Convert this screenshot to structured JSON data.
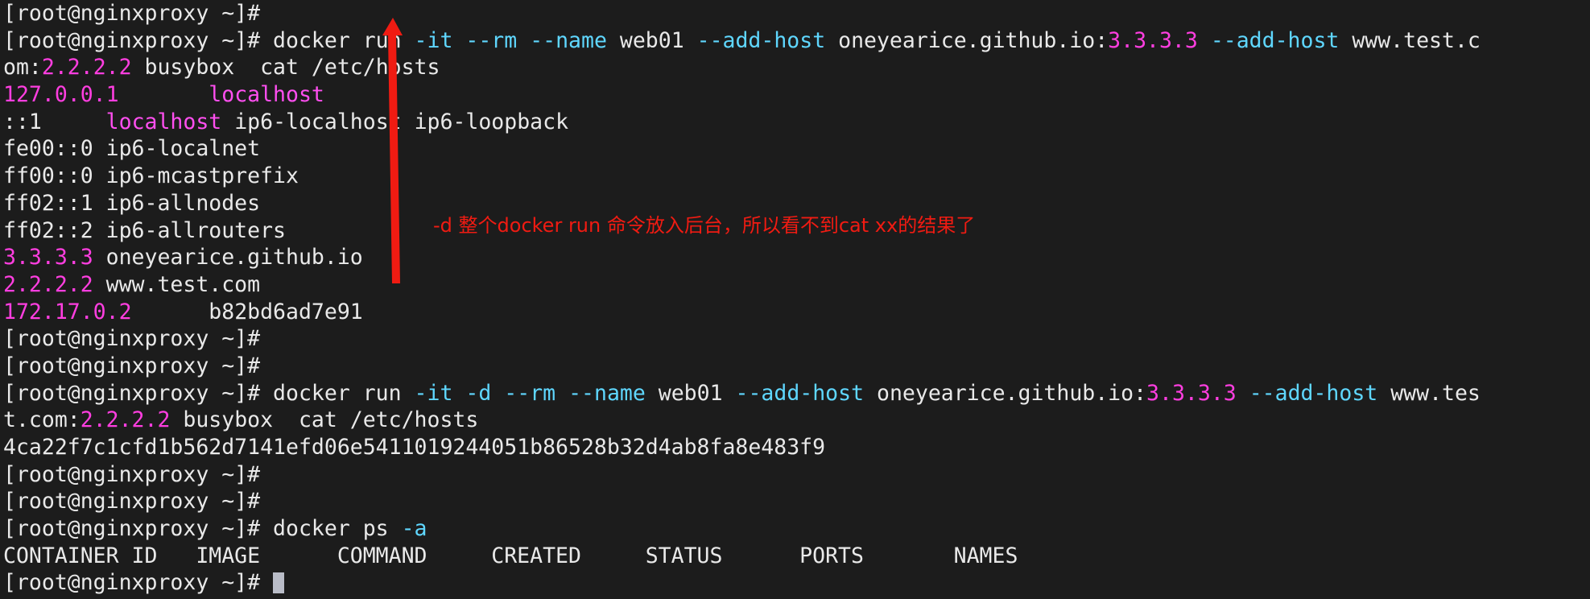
{
  "terminal": {
    "prompt": "[root@nginxproxy ~]# ",
    "background_color": "#1c1c1c",
    "foreground_color": "#e9e9e9",
    "flag_color": "#5fd7ff",
    "ip_color": "#ff3ee0",
    "annotation_color": "#f01b12",
    "cursor_color": "#b9bcc7",
    "lines": {
      "l00_prompt_partial": "[root@nginxproxy ~]#",
      "l01_prompt": "[root@nginxproxy ~]# ",
      "l01_cmd_docker": "docker run ",
      "l01_flag_it": "-it",
      "l01_sp1": " ",
      "l01_flag_rm": "--rm",
      "l01_sp2": " ",
      "l01_flag_name": "--name",
      "l01_name_val": " web01 ",
      "l01_flag_addhost1": "--add-host",
      "l01_host1": " oneyearice.github.io:",
      "l01_ip1": "3.3.3.3",
      "l01_sp3": " ",
      "l01_flag_addhost2": "--add-host",
      "l01_host2": " www.test.c",
      "l02_wrap_host2": "om:",
      "l02_ip2": "2.2.2.2",
      "l02_rest": " busybox  cat /etc/hosts",
      "l03_ip": "127.0.0.1",
      "l03_gap": "       ",
      "l03_host": "localhost",
      "l04_addr": "::1",
      "l04_gap": "     ",
      "l04_host_hl": "localhost",
      "l04_rest": " ip6-localhost ip6-loopback",
      "l05": "fe00::0 ip6-localnet",
      "l06": "ff00::0 ip6-mcastprefix",
      "l07": "ff02::1 ip6-allnodes",
      "l08": "ff02::2 ip6-allrouters",
      "l09_ip": "3.3.3.3",
      "l09_host": " oneyearice.github.io",
      "l10_ip": "2.2.2.2",
      "l10_host": " www.test.com",
      "l11_ip": "172.17.0.2",
      "l11_gap": "      ",
      "l11_host": "b82bd6ad7e91",
      "l12_prompt": "[root@nginxproxy ~]#",
      "l13_prompt": "[root@nginxproxy ~]#",
      "l14_prompt": "[root@nginxproxy ~]# ",
      "l14_cmd_docker": "docker run ",
      "l14_flag_it": "-it",
      "l14_sp1": " ",
      "l14_flag_d": "-d",
      "l14_sp2": " ",
      "l14_flag_rm": "--rm",
      "l14_sp3": " ",
      "l14_flag_name": "--name",
      "l14_name_val": " web01 ",
      "l14_flag_addhost1": "--add-host",
      "l14_host1": " oneyearice.github.io:",
      "l14_ip1": "3.3.3.3",
      "l14_sp4": " ",
      "l14_flag_addhost2": "--add-host",
      "l14_host2": " www.tes",
      "l15_wrap_host2": "t.com:",
      "l15_ip2": "2.2.2.2",
      "l15_rest": " busybox  cat /etc/hosts",
      "l16_container_id": "4ca22f7c1cfd1b562d7141efd06e5411019244051b86528b32d4ab8fa8e483f9",
      "l17_prompt": "[root@nginxproxy ~]#",
      "l18_prompt": "[root@nginxproxy ~]#",
      "l19_prompt": "[root@nginxproxy ~]# ",
      "l19_cmd": "docker ps ",
      "l19_flag_a": "-a",
      "l20_headers": "CONTAINER ID   IMAGE      COMMAND     CREATED     STATUS      PORTS       NAMES",
      "l21_prompt": "[root@nginxproxy ~]# "
    },
    "ps_table": {
      "columns": [
        "CONTAINER ID",
        "IMAGE",
        "COMMAND",
        "CREATED",
        "STATUS",
        "PORTS",
        "NAMES"
      ],
      "rows": []
    },
    "annotation": {
      "text": "-d 整个docker run 命令放入后台，所以看不到cat xx的结果了",
      "arrow": "up-arrow-red"
    }
  }
}
